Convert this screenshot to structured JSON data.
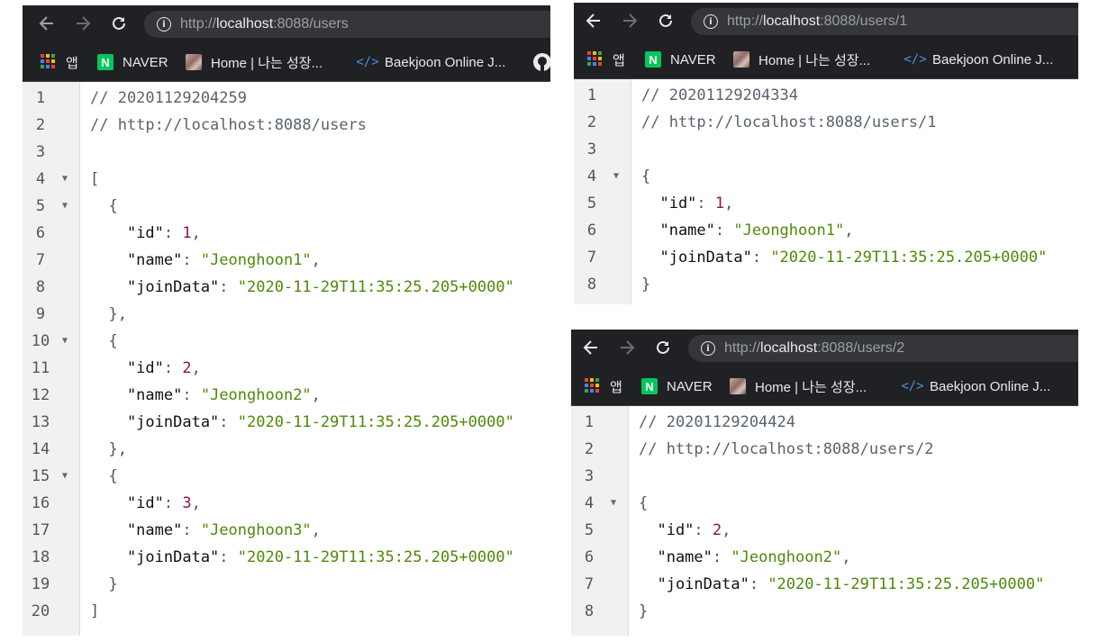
{
  "bookmarks": {
    "apps": "앱",
    "naver_icon_letter": "N",
    "naver": "NAVER",
    "home": "Home | 나는 성장...",
    "baekjoon_icon": "</>",
    "baekjoon": "Baekjoon Online J..."
  },
  "colors": {
    "browser_chrome": "#202124",
    "url_field": "#35363a",
    "json_string": "#4d8a08",
    "json_number": "#8b1456",
    "comment": "#59636e"
  },
  "windows": [
    {
      "url_scheme": "http://",
      "url_host": "localhost",
      "url_rest": ":8088/users",
      "lines": [
        {
          "n": "1",
          "fold": "",
          "tokens": [
            {
              "c": "cm",
              "t": "// 20201129204259"
            }
          ]
        },
        {
          "n": "2",
          "fold": "",
          "tokens": [
            {
              "c": "cm",
              "t": "// http://localhost:8088/users"
            }
          ]
        },
        {
          "n": "3",
          "fold": "",
          "tokens": []
        },
        {
          "n": "4",
          "fold": "▼",
          "tokens": [
            {
              "c": "pun",
              "t": "["
            }
          ]
        },
        {
          "n": "5",
          "fold": "▼",
          "tokens": [
            {
              "c": "pun",
              "t": "  {"
            }
          ]
        },
        {
          "n": "6",
          "fold": "",
          "tokens": [
            {
              "c": "key",
              "t": "    \"id\""
            },
            {
              "c": "pun",
              "t": ": "
            },
            {
              "c": "num",
              "t": "1"
            },
            {
              "c": "pun",
              "t": ","
            }
          ]
        },
        {
          "n": "7",
          "fold": "",
          "tokens": [
            {
              "c": "key",
              "t": "    \"name\""
            },
            {
              "c": "pun",
              "t": ": "
            },
            {
              "c": "str",
              "t": "\"Jeonghoon1\""
            },
            {
              "c": "pun",
              "t": ","
            }
          ]
        },
        {
          "n": "8",
          "fold": "",
          "tokens": [
            {
              "c": "key",
              "t": "    \"joinData\""
            },
            {
              "c": "pun",
              "t": ": "
            },
            {
              "c": "str",
              "t": "\"2020-11-29T11:35:25.205+0000\""
            }
          ]
        },
        {
          "n": "9",
          "fold": "",
          "tokens": [
            {
              "c": "pun",
              "t": "  },"
            }
          ]
        },
        {
          "n": "10",
          "fold": "▼",
          "tokens": [
            {
              "c": "pun",
              "t": "  {"
            }
          ]
        },
        {
          "n": "11",
          "fold": "",
          "tokens": [
            {
              "c": "key",
              "t": "    \"id\""
            },
            {
              "c": "pun",
              "t": ": "
            },
            {
              "c": "num",
              "t": "2"
            },
            {
              "c": "pun",
              "t": ","
            }
          ]
        },
        {
          "n": "12",
          "fold": "",
          "tokens": [
            {
              "c": "key",
              "t": "    \"name\""
            },
            {
              "c": "pun",
              "t": ": "
            },
            {
              "c": "str",
              "t": "\"Jeonghoon2\""
            },
            {
              "c": "pun",
              "t": ","
            }
          ]
        },
        {
          "n": "13",
          "fold": "",
          "tokens": [
            {
              "c": "key",
              "t": "    \"joinData\""
            },
            {
              "c": "pun",
              "t": ": "
            },
            {
              "c": "str",
              "t": "\"2020-11-29T11:35:25.205+0000\""
            }
          ]
        },
        {
          "n": "14",
          "fold": "",
          "tokens": [
            {
              "c": "pun",
              "t": "  },"
            }
          ]
        },
        {
          "n": "15",
          "fold": "▼",
          "tokens": [
            {
              "c": "pun",
              "t": "  {"
            }
          ]
        },
        {
          "n": "16",
          "fold": "",
          "tokens": [
            {
              "c": "key",
              "t": "    \"id\""
            },
            {
              "c": "pun",
              "t": ": "
            },
            {
              "c": "num",
              "t": "3"
            },
            {
              "c": "pun",
              "t": ","
            }
          ]
        },
        {
          "n": "17",
          "fold": "",
          "tokens": [
            {
              "c": "key",
              "t": "    \"name\""
            },
            {
              "c": "pun",
              "t": ": "
            },
            {
              "c": "str",
              "t": "\"Jeonghoon3\""
            },
            {
              "c": "pun",
              "t": ","
            }
          ]
        },
        {
          "n": "18",
          "fold": "",
          "tokens": [
            {
              "c": "key",
              "t": "    \"joinData\""
            },
            {
              "c": "pun",
              "t": ": "
            },
            {
              "c": "str",
              "t": "\"2020-11-29T11:35:25.205+0000\""
            }
          ]
        },
        {
          "n": "19",
          "fold": "",
          "tokens": [
            {
              "c": "pun",
              "t": "  }"
            }
          ]
        },
        {
          "n": "20",
          "fold": "",
          "tokens": [
            {
              "c": "pun",
              "t": "]"
            }
          ]
        }
      ]
    },
    {
      "url_scheme": "http://",
      "url_host": "localhost",
      "url_rest": ":8088/users/1",
      "lines": [
        {
          "n": "1",
          "fold": "",
          "tokens": [
            {
              "c": "cm",
              "t": "// 20201129204334"
            }
          ]
        },
        {
          "n": "2",
          "fold": "",
          "tokens": [
            {
              "c": "cm",
              "t": "// http://localhost:8088/users/1"
            }
          ]
        },
        {
          "n": "3",
          "fold": "",
          "tokens": []
        },
        {
          "n": "4",
          "fold": "▼",
          "tokens": [
            {
              "c": "pun",
              "t": "{"
            }
          ]
        },
        {
          "n": "5",
          "fold": "",
          "tokens": [
            {
              "c": "key",
              "t": "  \"id\""
            },
            {
              "c": "pun",
              "t": ": "
            },
            {
              "c": "num",
              "t": "1"
            },
            {
              "c": "pun",
              "t": ","
            }
          ]
        },
        {
          "n": "6",
          "fold": "",
          "tokens": [
            {
              "c": "key",
              "t": "  \"name\""
            },
            {
              "c": "pun",
              "t": ": "
            },
            {
              "c": "str",
              "t": "\"Jeonghoon1\""
            },
            {
              "c": "pun",
              "t": ","
            }
          ]
        },
        {
          "n": "7",
          "fold": "",
          "tokens": [
            {
              "c": "key",
              "t": "  \"joinData\""
            },
            {
              "c": "pun",
              "t": ": "
            },
            {
              "c": "str",
              "t": "\"2020-11-29T11:35:25.205+0000\""
            }
          ]
        },
        {
          "n": "8",
          "fold": "",
          "tokens": [
            {
              "c": "pun",
              "t": "}"
            }
          ]
        }
      ]
    },
    {
      "url_scheme": "http://",
      "url_host": "localhost",
      "url_rest": ":8088/users/2",
      "lines": [
        {
          "n": "1",
          "fold": "",
          "tokens": [
            {
              "c": "cm",
              "t": "// 20201129204424"
            }
          ]
        },
        {
          "n": "2",
          "fold": "",
          "tokens": [
            {
              "c": "cm",
              "t": "// http://localhost:8088/users/2"
            }
          ]
        },
        {
          "n": "3",
          "fold": "",
          "tokens": []
        },
        {
          "n": "4",
          "fold": "▼",
          "tokens": [
            {
              "c": "pun",
              "t": "{"
            }
          ]
        },
        {
          "n": "5",
          "fold": "",
          "tokens": [
            {
              "c": "key",
              "t": "  \"id\""
            },
            {
              "c": "pun",
              "t": ": "
            },
            {
              "c": "num",
              "t": "2"
            },
            {
              "c": "pun",
              "t": ","
            }
          ]
        },
        {
          "n": "6",
          "fold": "",
          "tokens": [
            {
              "c": "key",
              "t": "  \"name\""
            },
            {
              "c": "pun",
              "t": ": "
            },
            {
              "c": "str",
              "t": "\"Jeonghoon2\""
            },
            {
              "c": "pun",
              "t": ","
            }
          ]
        },
        {
          "n": "7",
          "fold": "",
          "tokens": [
            {
              "c": "key",
              "t": "  \"joinData\""
            },
            {
              "c": "pun",
              "t": ": "
            },
            {
              "c": "str",
              "t": "\"2020-11-29T11:35:25.205+0000\""
            }
          ]
        },
        {
          "n": "8",
          "fold": "",
          "tokens": [
            {
              "c": "pun",
              "t": "}"
            }
          ]
        }
      ]
    }
  ]
}
